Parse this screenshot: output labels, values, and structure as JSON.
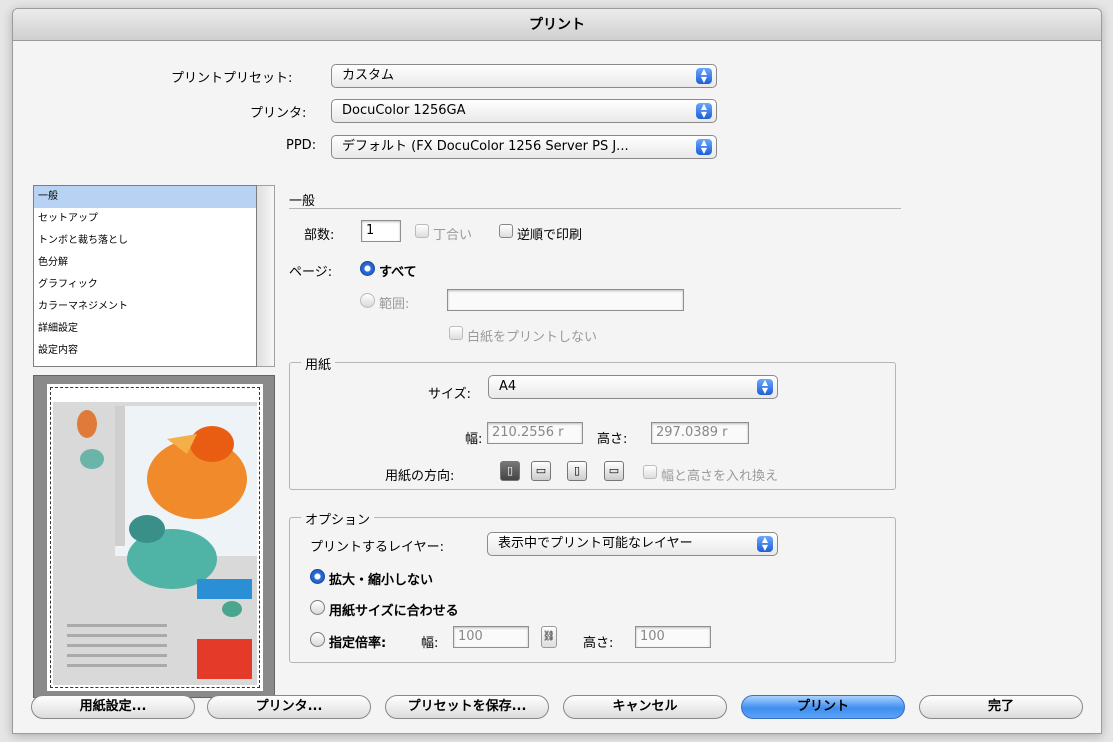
{
  "window": {
    "title": "プリント"
  },
  "top": {
    "preset_label": "プリントプリセット:",
    "preset_value": "カスタム",
    "printer_label": "プリンタ:",
    "printer_value": "DocuColor 1256GA",
    "ppd_label": "PPD:",
    "ppd_value": "デフォルト (FX DocuColor 1256 Server PS J..."
  },
  "sidebar": {
    "items": [
      {
        "label": "一般"
      },
      {
        "label": "セットアップ"
      },
      {
        "label": "トンボと裁ち落とし"
      },
      {
        "label": "色分解"
      },
      {
        "label": "グラフィック"
      },
      {
        "label": "カラーマネジメント"
      },
      {
        "label": "詳細設定"
      },
      {
        "label": "設定内容"
      }
    ],
    "selected_index": 0
  },
  "general": {
    "title": "一般",
    "copies_label": "部数:",
    "copies_value": "1",
    "collate_label": "丁合い",
    "reverse_label": "逆順で印刷",
    "pages_label": "ページ:",
    "all_label": "すべて",
    "range_label": "範囲:",
    "range_value": "",
    "skip_blank_label": "白紙をプリントしない"
  },
  "paper": {
    "title": "用紙",
    "size_label": "サイズ:",
    "size_value": "A4",
    "width_label": "幅:",
    "width_value": "210.2556 r",
    "height_label": "高さ:",
    "height_value": "297.0389 r",
    "orientation_label": "用紙の方向:",
    "swap_label": "幅と高さを入れ換え"
  },
  "options": {
    "title": "オプション",
    "layers_label": "プリントするレイヤー:",
    "layers_value": "表示中でプリント可能なレイヤー",
    "no_scale_label": "拡大・縮小しない",
    "fit_label": "用紙サイズに合わせる",
    "custom_label": "指定倍率:",
    "w_label": "幅:",
    "w_value": "100",
    "h_label": "高さ:",
    "h_value": "100"
  },
  "buttons": {
    "page_setup": "用紙設定...",
    "printer": "プリンタ...",
    "save_preset": "プリセットを保存...",
    "cancel": "キャンセル",
    "print": "プリント",
    "done": "完了"
  },
  "colors": {
    "accent": "#3f8ef0",
    "selection": "#b7d2f2"
  }
}
